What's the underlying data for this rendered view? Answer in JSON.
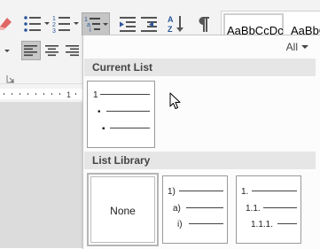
{
  "ribbon": {
    "styles": {
      "normal": "AaBbCcDc",
      "no_spacing": "AaBbCc"
    }
  },
  "dropdown": {
    "filter": "All",
    "current_list_header": "Current List",
    "library_header": "List Library",
    "none_label": "None",
    "current_list": {
      "levels": [
        "1",
        "•",
        "▪"
      ]
    },
    "library": {
      "alpha_style": {
        "levels": [
          "1)",
          "a)",
          "i)"
        ]
      },
      "decimal_style": {
        "levels": [
          "1.",
          "1.1.",
          "1.1.1."
        ]
      }
    }
  },
  "colors": {
    "ribbon_bg": "#f3f3f3",
    "section_header_bg": "#e6e6e6",
    "pressed_button": "#c5c5c5"
  }
}
